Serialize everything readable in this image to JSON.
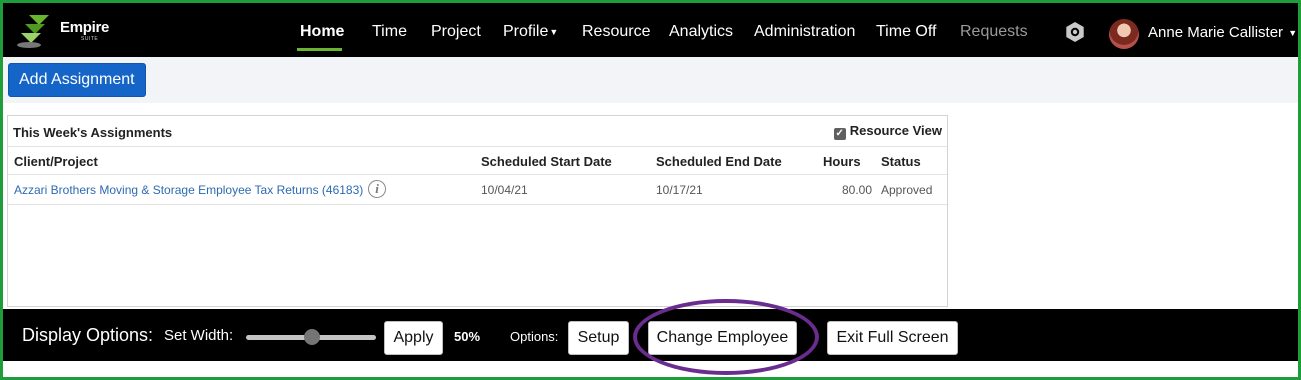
{
  "app": {
    "brand": "Empire",
    "brand_sub": "SUITE"
  },
  "nav": {
    "items": [
      {
        "label": "Home",
        "active": true
      },
      {
        "label": "Time"
      },
      {
        "label": "Project"
      },
      {
        "label": "Profile",
        "has_caret": true
      },
      {
        "label": "Resource"
      },
      {
        "label": "Analytics"
      },
      {
        "label": "Administration"
      },
      {
        "label": "Time Off"
      },
      {
        "label": "Requests",
        "dimmed": true
      }
    ],
    "user_name": "Anne Marie Callister",
    "accent_color": "#6ab52f"
  },
  "toolbar": {
    "add_label": "Add Assignment",
    "add_color": "#1565c8"
  },
  "assignments": {
    "title": "This Week's Assignments",
    "resource_view_label": "Resource View",
    "resource_view_checked": true,
    "columns": [
      "Client/Project",
      "Scheduled Start Date",
      "Scheduled End Date",
      "Hours",
      "Status"
    ],
    "rows": [
      {
        "project": "Azzari Brothers Moving & Storage Employee Tax Returns (46183)",
        "start": "10/04/21",
        "end": "10/17/21",
        "hours": "80.00",
        "status": "Approved"
      }
    ]
  },
  "display_options": {
    "title": "Display Options:",
    "set_width_label": "Set Width:",
    "width_value": 50,
    "apply_label": "Apply",
    "width_text": "50%",
    "options_label": "Options:",
    "setup_label": "Setup",
    "change_employee_label": "Change Employee",
    "exit_full_screen_label": "Exit Full Screen"
  },
  "annotation": {
    "highlight_color": "#6a2c8f",
    "frame_color": "#1f9d3a"
  }
}
